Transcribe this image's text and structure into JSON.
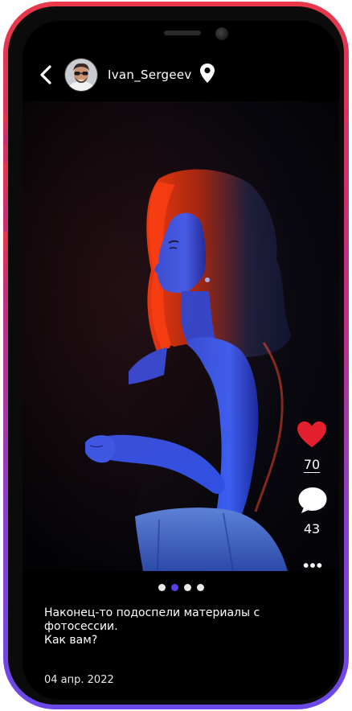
{
  "header": {
    "username": "Ivan_Sergeev"
  },
  "post": {
    "likes": "70",
    "comments": "43",
    "caption": "Наконец-то подоспели материалы с\nфотосессии.\nКак вам?",
    "date": "04 апр. 2022",
    "carousel": {
      "total": 4,
      "active_index": 1
    }
  },
  "colors": {
    "accent": "#5b3ee8",
    "like": "#e5202e",
    "bezel_top": "#e8384a",
    "bezel_bottom": "#6a48e8"
  },
  "icons": [
    "back-chevron-icon",
    "location-pin-icon",
    "heart-icon",
    "comment-bubble-icon",
    "more-dots-icon"
  ]
}
